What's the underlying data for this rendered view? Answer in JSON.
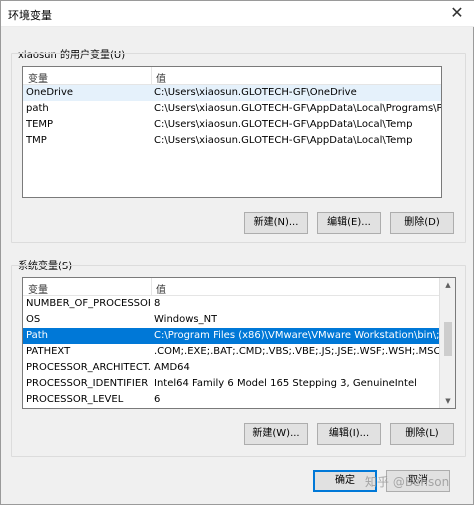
{
  "window": {
    "title": "环境变量",
    "close_glyph": "✕"
  },
  "user_section": {
    "label": "xiaosun 的用户变量(U)",
    "columns": [
      "变量",
      "值"
    ],
    "rows": [
      {
        "name": "OneDrive",
        "value": "C:\\Users\\xiaosun.GLOTECH-GF\\OneDrive"
      },
      {
        "name": "path",
        "value": "C:\\Users\\xiaosun.GLOTECH-GF\\AppData\\Local\\Programs\\Pyt..."
      },
      {
        "name": "TEMP",
        "value": "C:\\Users\\xiaosun.GLOTECH-GF\\AppData\\Local\\Temp"
      },
      {
        "name": "TMP",
        "value": "C:\\Users\\xiaosun.GLOTECH-GF\\AppData\\Local\\Temp"
      }
    ],
    "buttons": {
      "new": "新建(N)...",
      "edit": "编辑(E)...",
      "delete": "删除(D)"
    }
  },
  "system_section": {
    "label": "系统变量(S)",
    "columns": [
      "变量",
      "值"
    ],
    "rows": [
      {
        "name": "NUMBER_OF_PROCESSORS",
        "value": "8"
      },
      {
        "name": "OS",
        "value": "Windows_NT"
      },
      {
        "name": "Path",
        "value": "C:\\Program Files (x86)\\VMware\\VMware Workstation\\bin\\;C:\\..."
      },
      {
        "name": "PATHEXT",
        "value": ".COM;.EXE;.BAT;.CMD;.VBS;.VBE;.JS;.JSE;.WSF;.WSH;.MSC"
      },
      {
        "name": "PROCESSOR_ARCHITECT...",
        "value": "AMD64"
      },
      {
        "name": "PROCESSOR_IDENTIFIER",
        "value": "Intel64 Family 6 Model 165 Stepping 3, GenuineIntel"
      },
      {
        "name": "PROCESSOR_LEVEL",
        "value": "6"
      }
    ],
    "selected_row": "Path",
    "buttons": {
      "new": "新建(W)...",
      "edit": "编辑(I)...",
      "delete": "删除(L)"
    }
  },
  "footer": {
    "ok": "确定",
    "cancel": "取消"
  },
  "watermark": "知乎 @Benson"
}
